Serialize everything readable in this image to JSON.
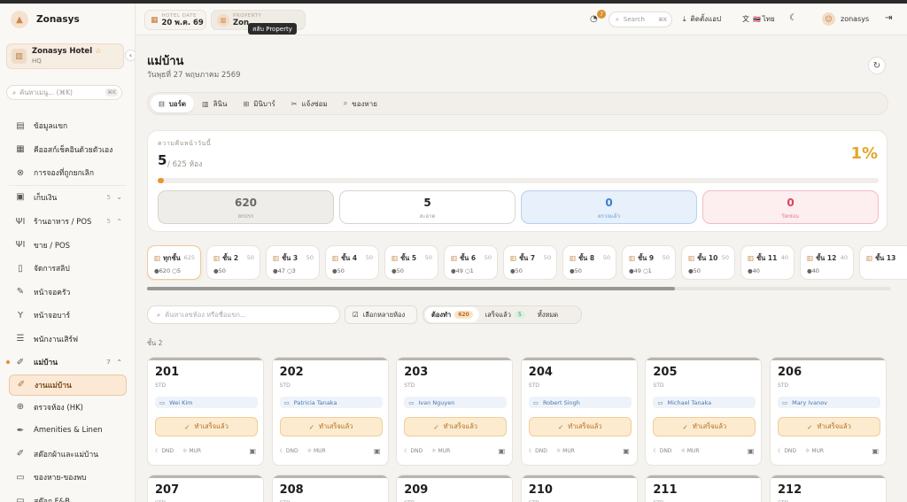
{
  "brand": {
    "name": "Zonasys"
  },
  "hotel": {
    "name": "Zonasys Hotel",
    "sub": "HQ"
  },
  "sidebar": {
    "search_placeholder": "ค้นหาเมนู... (⌘K)",
    "search_kbd": "⌘K",
    "items": [
      {
        "label": "ข้อมูลแขก",
        "icon": "user-info-icon"
      },
      {
        "label": "คีออสก์เช็คอินด้วยตัวเอง",
        "icon": "grid-icon"
      },
      {
        "label": "การจองที่ถูกยกเลิก",
        "icon": "cancel-icon"
      },
      {
        "label": "เก็บเงิน",
        "icon": "money-icon",
        "count": "5",
        "chevron": "⌄"
      },
      {
        "label": "ร้านอาหาร / POS",
        "icon": "fork-knife-icon",
        "count": "5",
        "chevron": "⌃"
      },
      {
        "label": "ขาย / POS",
        "icon": "fork-knife-icon"
      },
      {
        "label": "จัดการสลิป",
        "icon": "receipt-icon"
      },
      {
        "label": "หน้าจอครัว",
        "icon": "kitchen-icon"
      },
      {
        "label": "หน้าจอบาร์",
        "icon": "cocktail-icon"
      },
      {
        "label": "พนักงานเสิร์ฟ",
        "icon": "list-icon"
      },
      {
        "label": "แม่บ้าน",
        "icon": "broom-icon",
        "count": "7",
        "chevron": "⌃"
      },
      {
        "label": "งานแม่บ้าน",
        "icon": "broom-icon"
      },
      {
        "label": "ตรวจห้อง (HK)",
        "icon": "inspect-icon"
      },
      {
        "label": "Amenities & Linen",
        "icon": "brush-icon"
      },
      {
        "label": "สต๊อกผ้าและแม่บ้าน",
        "icon": "broom-icon"
      },
      {
        "label": "ของหาย-ของพบ",
        "icon": "box-icon"
      },
      {
        "label": "สต๊อก F&B",
        "icon": "box-icon"
      }
    ]
  },
  "header": {
    "hotel_date_label": "HOTEL DATE",
    "hotel_date": "20 พ.ค. 69",
    "property_label": "PROPERTY",
    "property": "Zon",
    "tooltip": "สลับ Property",
    "notif_count": "7",
    "search": "Search",
    "search_kbd": "⌘K",
    "install": "ติดตั้งแอป",
    "lang": "ไทย",
    "lang_flag": "🇹🇭",
    "user": "zonasys"
  },
  "page": {
    "title": "แม่บ้าน",
    "date": "วันพุธที่ 27 พฤษภาคม 2569"
  },
  "tabs": [
    {
      "label": "บอร์ด",
      "icon": "bed-icon"
    },
    {
      "label": "ลินิน",
      "icon": "linen-icon"
    },
    {
      "label": "มินิบาร์",
      "icon": "minibar-icon"
    },
    {
      "label": "แจ้งซ่อม",
      "icon": "tools-icon"
    },
    {
      "label": "ของหาย",
      "icon": "search-icon"
    }
  ],
  "progress": {
    "label": "ความคืบหน้าวันนี้",
    "value": "5",
    "total": "/ 625 ห้อง",
    "percent_text": "1%",
    "fraction": 0.008,
    "stats": [
      {
        "n": "620",
        "t": "สกปรก"
      },
      {
        "n": "5",
        "t": "สะอาด"
      },
      {
        "n": "0",
        "t": "ตรวจแล้ว"
      },
      {
        "n": "0",
        "t": "ปิดซ่อม"
      }
    ]
  },
  "floors": [
    {
      "name": "ทุกชั้น",
      "count": "625",
      "s": "●620 ○5"
    },
    {
      "name": "ชั้น 2",
      "count": "50",
      "s": "●50"
    },
    {
      "name": "ชั้น 3",
      "count": "50",
      "s": "●47 ○3"
    },
    {
      "name": "ชั้น 4",
      "count": "50",
      "s": "●50"
    },
    {
      "name": "ชั้น 5",
      "count": "50",
      "s": "●50"
    },
    {
      "name": "ชั้น 6",
      "count": "50",
      "s": "●49 ○1"
    },
    {
      "name": "ชั้น 7",
      "count": "50",
      "s": "●50"
    },
    {
      "name": "ชั้น 8",
      "count": "50",
      "s": "●50"
    },
    {
      "name": "ชั้น 9",
      "count": "50",
      "s": "●49 ○1"
    },
    {
      "name": "ชั้น 10",
      "count": "50",
      "s": "●50"
    },
    {
      "name": "ชั้น 11",
      "count": "40",
      "s": "●40"
    },
    {
      "name": "ชั้น 12",
      "count": "40",
      "s": "●40"
    },
    {
      "name": "ชั้น 13",
      "count": "",
      "s": ""
    }
  ],
  "filters": {
    "search_placeholder": "ค้นหาเลขห้อง หรือชื่อแขก...",
    "multi": "เลือกหลายห้อง",
    "seg": [
      {
        "label": "ต้องทำ",
        "badge": "620"
      },
      {
        "label": "เสร็จแล้ว",
        "badge": "5"
      },
      {
        "label": "ทั้งหมด",
        "badge": ""
      }
    ]
  },
  "floor_heading": "ชั้น 2",
  "room_labels": {
    "done": "ทำเสร็จแล้ว",
    "dnd": "DND",
    "mur": "MUR"
  },
  "rooms": [
    {
      "num": "201",
      "type": "STD",
      "guest": "Wei Kim"
    },
    {
      "num": "202",
      "type": "STD",
      "guest": "Patricia Tanaka"
    },
    {
      "num": "203",
      "type": "STD",
      "guest": "Ivan Nguyen"
    },
    {
      "num": "204",
      "type": "STD",
      "guest": "Robert Singh"
    },
    {
      "num": "205",
      "type": "STD",
      "guest": "Michael Tanaka"
    },
    {
      "num": "206",
      "type": "STD",
      "guest": "Mary Ivanov"
    },
    {
      "num": "207",
      "type": "STD",
      "guest": ""
    },
    {
      "num": "208",
      "type": "STD",
      "guest": ""
    },
    {
      "num": "209",
      "type": "STD",
      "guest": ""
    },
    {
      "num": "210",
      "type": "STD",
      "guest": ""
    },
    {
      "num": "211",
      "type": "STD",
      "guest": ""
    },
    {
      "num": "212",
      "type": "STD",
      "guest": ""
    }
  ]
}
